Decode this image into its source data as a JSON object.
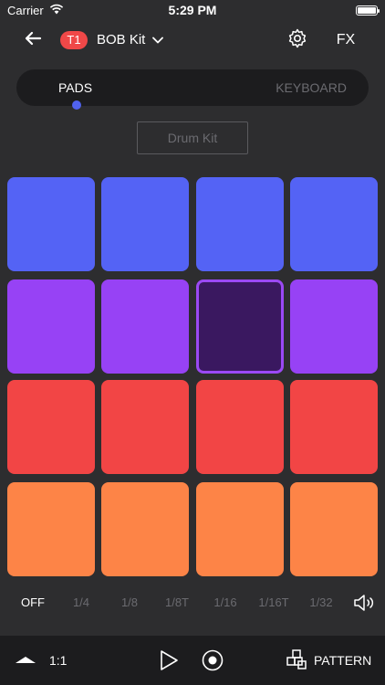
{
  "status": {
    "carrier": "Carrier",
    "time": "5:29 PM"
  },
  "header": {
    "track_badge": "T1",
    "kit_name": "BOB Kit",
    "fx_label": "FX"
  },
  "tabs": {
    "pads": "PADS",
    "keyboard": "KEYBOARD",
    "selected": "PADS"
  },
  "kit_button": {
    "label": "Drum Kit"
  },
  "colors": {
    "blue": "#5463f5",
    "purple": "#9742f5",
    "purple_active_fill": "#3a1860",
    "red": "#f24545",
    "orange": "#fd8447",
    "accent": "#5062ef",
    "badge": "#f04848"
  },
  "pads": [
    {
      "color": "#5463f5"
    },
    {
      "color": "#5463f5"
    },
    {
      "color": "#5463f5"
    },
    {
      "color": "#5463f5"
    },
    {
      "color": "#9742f5"
    },
    {
      "color": "#9742f5"
    },
    {
      "color": "#3a1860",
      "active": true
    },
    {
      "color": "#9742f5"
    },
    {
      "color": "#f24545"
    },
    {
      "color": "#f24545"
    },
    {
      "color": "#f24545"
    },
    {
      "color": "#f24545"
    },
    {
      "color": "#fd8447"
    },
    {
      "color": "#fd8447"
    },
    {
      "color": "#fd8447"
    },
    {
      "color": "#fd8447"
    }
  ],
  "note_repeat": {
    "options": [
      "OFF",
      "1/4",
      "1/8",
      "1/8T",
      "1/16",
      "1/16T",
      "1/32"
    ],
    "selected": "OFF"
  },
  "transport": {
    "ratio": "1:1",
    "pattern_label": "PATTERN"
  },
  "icons": [
    "back-arrow-icon",
    "chevron-down-icon",
    "gear-icon",
    "speaker-icon",
    "triangle-up-icon",
    "play-icon",
    "record-icon",
    "pattern-grid-icon",
    "wifi-icon",
    "battery-icon"
  ]
}
